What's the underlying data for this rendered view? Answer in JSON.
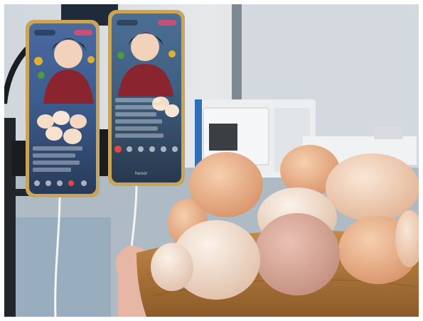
{
  "scene": {
    "description_free": true,
    "phones": [
      {
        "id": "left-phone",
        "brand_mark": ""
      },
      {
        "id": "right-phone",
        "brand_mark": "honor"
      }
    ]
  }
}
